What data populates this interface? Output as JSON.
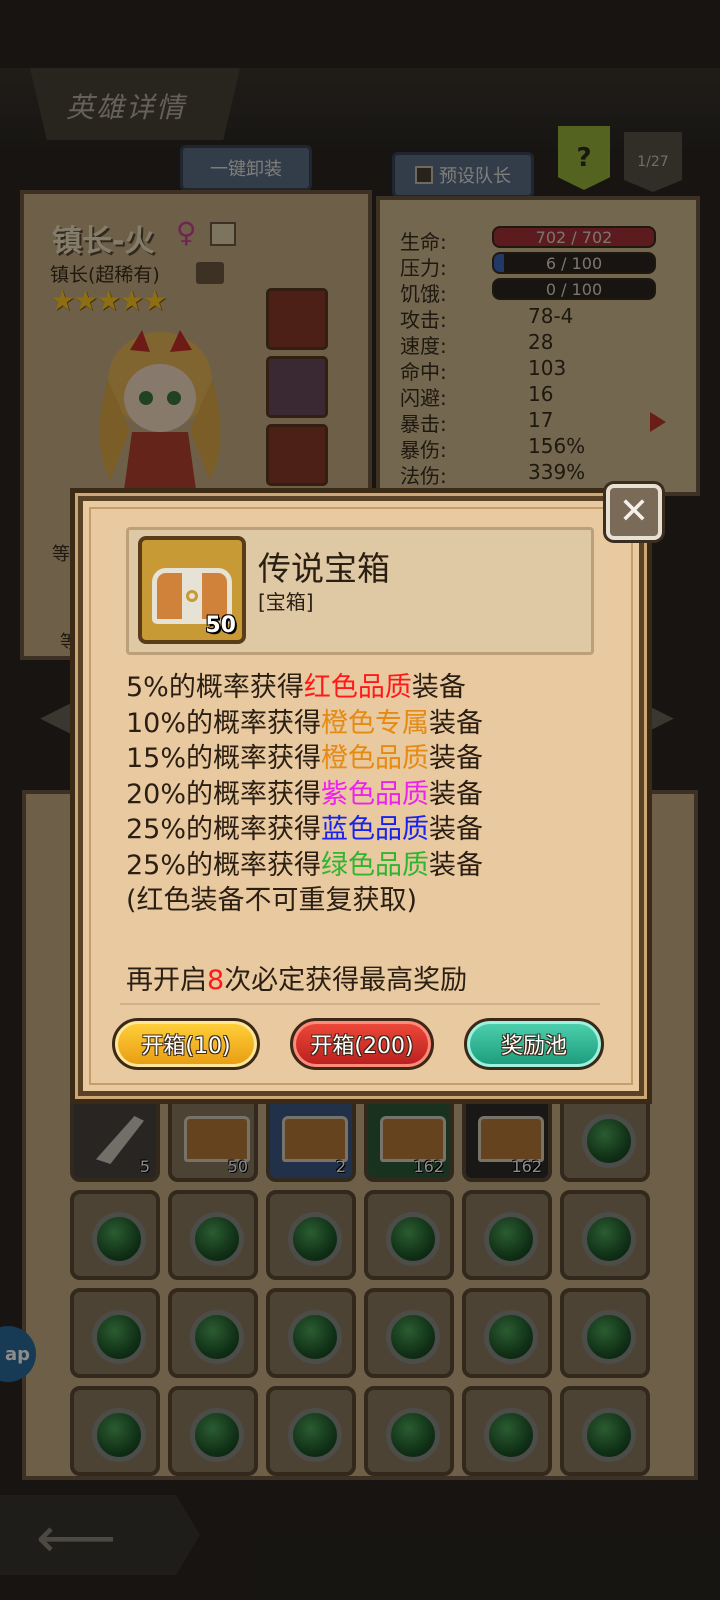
{
  "header": {
    "title": "英雄详情",
    "unequip_label": "一键卸装",
    "captain_label": "预设队长",
    "help_label": "?",
    "page_indicator": "1/27"
  },
  "hero": {
    "name": "镇长-火",
    "gender_symbol": "♀",
    "class_label": "镇长(超稀有)",
    "stars": "★★★★★",
    "cut_label_1": "等",
    "cut_label_2": "等"
  },
  "stats": {
    "hp": {
      "label": "生命:",
      "value": "702 / 702"
    },
    "stress": {
      "label": "压力:",
      "value": "6 / 100"
    },
    "hunger": {
      "label": "饥饿:",
      "value": "0 / 100"
    },
    "rows": [
      {
        "label": "攻击:",
        "value": "78-4"
      },
      {
        "label": "速度:",
        "value": "28"
      },
      {
        "label": "命中:",
        "value": "103"
      },
      {
        "label": "闪避:",
        "value": "16"
      },
      {
        "label": "暴击:",
        "value": "17"
      },
      {
        "label": "暴伤:",
        "value": "156%"
      },
      {
        "label": "法伤:",
        "value": "339%"
      }
    ]
  },
  "inventory": {
    "counts": [
      "5",
      "50",
      "2",
      "162",
      "162"
    ]
  },
  "side_bubble": "ap",
  "dialog": {
    "item_name": "传说宝箱",
    "item_type": "[宝箱]",
    "item_count": "50",
    "lines": [
      {
        "prefix": "5%的概率获得",
        "highlight": "红色品质",
        "suffix": "装备",
        "color": "#ff1a1a"
      },
      {
        "prefix": "10%的概率获得",
        "highlight": "橙色专属",
        "suffix": "装备",
        "color": "#e58a12"
      },
      {
        "prefix": "15%的概率获得",
        "highlight": "橙色品质",
        "suffix": "装备",
        "color": "#e58a12"
      },
      {
        "prefix": "20%的概率获得",
        "highlight": "紫色品质",
        "suffix": "装备",
        "color": "#ee22ee"
      },
      {
        "prefix": "25%的概率获得",
        "highlight": "蓝色品质",
        "suffix": "装备",
        "color": "#1722ee"
      },
      {
        "prefix": "25%的概率获得",
        "highlight": "绿色品质",
        "suffix": "装备",
        "color": "#2fb52f"
      }
    ],
    "note": "(红色装备不可重复获取)",
    "hint_prefix": "再开启",
    "hint_number": "8",
    "hint_suffix": "次必定获得最高奖励",
    "buttons": {
      "open10": "开箱(10)",
      "open200": "开箱(200)",
      "pool": "奖励池"
    }
  }
}
